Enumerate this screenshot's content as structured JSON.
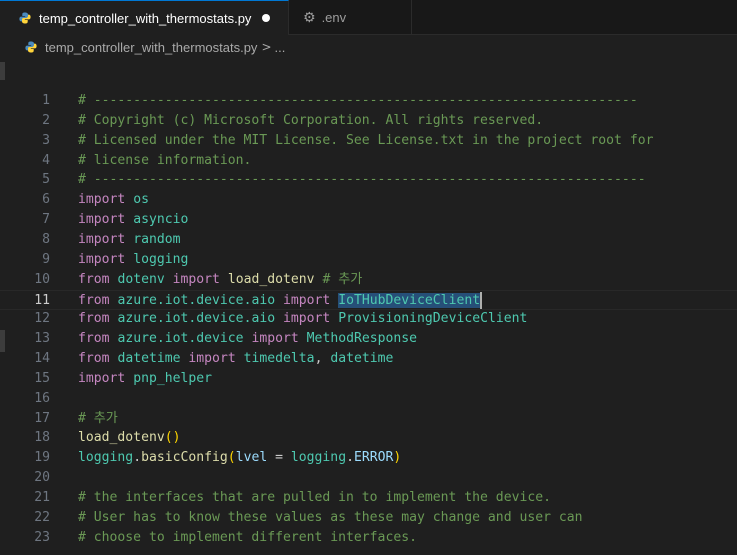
{
  "tabs": [
    {
      "label": "temp_controller_with_thermostats.py",
      "icon": "python-file-icon",
      "active": true,
      "modified": true
    },
    {
      "label": ".env",
      "icon": "gear-icon",
      "active": false
    }
  ],
  "breadcrumb": {
    "file": "temp_controller_with_thermostats.py",
    "separator": ">",
    "more": "..."
  },
  "colors": {
    "comment": "#6a9955",
    "keyword": "#c586c0",
    "module": "#4ec9b0",
    "function": "#dcdcaa",
    "variable": "#9cdcfe",
    "selection": "#264f78"
  },
  "current_line": 11,
  "lines": [
    {
      "n": "1",
      "tokens": [
        {
          "c": "cm",
          "t": "# ---------------------------------------------------------------------"
        }
      ]
    },
    {
      "n": "2",
      "tokens": [
        {
          "c": "cm",
          "t": "# Copyright (c) Microsoft Corporation. All rights reserved."
        }
      ]
    },
    {
      "n": "3",
      "tokens": [
        {
          "c": "cm",
          "t": "# Licensed under the MIT License. See License.txt in the project root for"
        }
      ]
    },
    {
      "n": "4",
      "tokens": [
        {
          "c": "cm",
          "t": "# license information."
        }
      ]
    },
    {
      "n": "5",
      "tokens": [
        {
          "c": "cm",
          "t": "# ----------------------------------------------------------------------"
        }
      ]
    },
    {
      "n": "6",
      "tokens": [
        {
          "c": "kw",
          "t": "import"
        },
        {
          "c": "pl",
          "t": " "
        },
        {
          "c": "mod",
          "t": "os"
        }
      ]
    },
    {
      "n": "7",
      "tokens": [
        {
          "c": "kw",
          "t": "import"
        },
        {
          "c": "pl",
          "t": " "
        },
        {
          "c": "mod",
          "t": "asyncio"
        }
      ]
    },
    {
      "n": "8",
      "tokens": [
        {
          "c": "kw",
          "t": "import"
        },
        {
          "c": "pl",
          "t": " "
        },
        {
          "c": "mod",
          "t": "random"
        }
      ]
    },
    {
      "n": "9",
      "tokens": [
        {
          "c": "kw",
          "t": "import"
        },
        {
          "c": "pl",
          "t": " "
        },
        {
          "c": "mod",
          "t": "logging"
        }
      ]
    },
    {
      "n": "10",
      "tokens": [
        {
          "c": "kw",
          "t": "from"
        },
        {
          "c": "pl",
          "t": " "
        },
        {
          "c": "mod",
          "t": "dotenv"
        },
        {
          "c": "pl",
          "t": " "
        },
        {
          "c": "kw",
          "t": "import"
        },
        {
          "c": "pl",
          "t": " "
        },
        {
          "c": "fn",
          "t": "load_dotenv"
        },
        {
          "c": "pl",
          "t": " "
        },
        {
          "c": "cm",
          "t": "# 추가"
        }
      ]
    },
    {
      "n": "11",
      "tokens": [
        {
          "c": "kw",
          "t": "from"
        },
        {
          "c": "pl",
          "t": " "
        },
        {
          "c": "mod",
          "t": "azure.iot.device.aio"
        },
        {
          "c": "pl",
          "t": " "
        },
        {
          "c": "kw",
          "t": "import"
        },
        {
          "c": "pl",
          "t": " "
        },
        {
          "c": "sel",
          "t": "IoTHubDeviceClient"
        }
      ]
    },
    {
      "n": "12",
      "tokens": [
        {
          "c": "kw",
          "t": "from"
        },
        {
          "c": "pl",
          "t": " "
        },
        {
          "c": "mod",
          "t": "azure.iot.device.aio"
        },
        {
          "c": "pl",
          "t": " "
        },
        {
          "c": "kw",
          "t": "import"
        },
        {
          "c": "pl",
          "t": " "
        },
        {
          "c": "mod",
          "t": "ProvisioningDeviceClient"
        }
      ]
    },
    {
      "n": "13",
      "tokens": [
        {
          "c": "kw",
          "t": "from"
        },
        {
          "c": "pl",
          "t": " "
        },
        {
          "c": "mod",
          "t": "azure.iot.device"
        },
        {
          "c": "pl",
          "t": " "
        },
        {
          "c": "kw",
          "t": "import"
        },
        {
          "c": "pl",
          "t": " "
        },
        {
          "c": "mod",
          "t": "MethodResponse"
        }
      ]
    },
    {
      "n": "14",
      "tokens": [
        {
          "c": "kw",
          "t": "from"
        },
        {
          "c": "pl",
          "t": " "
        },
        {
          "c": "mod",
          "t": "datetime"
        },
        {
          "c": "pl",
          "t": " "
        },
        {
          "c": "kw",
          "t": "import"
        },
        {
          "c": "pl",
          "t": " "
        },
        {
          "c": "mod",
          "t": "timedelta"
        },
        {
          "c": "pl",
          "t": ", "
        },
        {
          "c": "mod",
          "t": "datetime"
        }
      ]
    },
    {
      "n": "15",
      "tokens": [
        {
          "c": "kw",
          "t": "import"
        },
        {
          "c": "pl",
          "t": " "
        },
        {
          "c": "mod",
          "t": "pnp_helper"
        }
      ]
    },
    {
      "n": "16",
      "tokens": []
    },
    {
      "n": "17",
      "tokens": [
        {
          "c": "cm",
          "t": "# 추가"
        }
      ]
    },
    {
      "n": "18",
      "tokens": [
        {
          "c": "fn",
          "t": "load_dotenv"
        },
        {
          "c": "paren",
          "t": "()"
        }
      ]
    },
    {
      "n": "19",
      "tokens": [
        {
          "c": "mod",
          "t": "logging"
        },
        {
          "c": "pl",
          "t": "."
        },
        {
          "c": "fn",
          "t": "basicConfig"
        },
        {
          "c": "paren",
          "t": "("
        },
        {
          "c": "var",
          "t": "lvel"
        },
        {
          "c": "pl",
          "t": " = "
        },
        {
          "c": "mod",
          "t": "logging"
        },
        {
          "c": "pl",
          "t": "."
        },
        {
          "c": "var",
          "t": "ERROR"
        },
        {
          "c": "paren",
          "t": ")"
        }
      ]
    },
    {
      "n": "20",
      "tokens": []
    },
    {
      "n": "21",
      "tokens": [
        {
          "c": "cm",
          "t": "# the interfaces that are pulled in to implement the device."
        }
      ]
    },
    {
      "n": "22",
      "tokens": [
        {
          "c": "cm",
          "t": "# User has to know these values as these may change and user can"
        }
      ]
    },
    {
      "n": "23",
      "tokens": [
        {
          "c": "cm",
          "t": "# choose to implement different interfaces."
        }
      ]
    }
  ]
}
